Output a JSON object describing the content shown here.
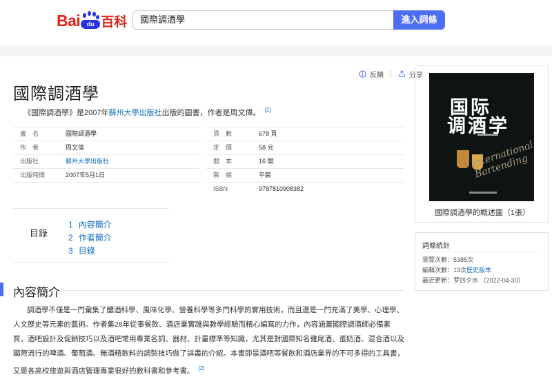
{
  "header": {
    "logo_bai": "Bai",
    "logo_du": "du",
    "logo_baike": "百科",
    "search_value": "國際調酒學",
    "search_button": "進入詞條"
  },
  "page": {
    "title": "國際調酒學",
    "actions": {
      "feedback": "反饋",
      "share": "分享"
    },
    "summary_pre": "《國際調酒學》是2007年",
    "summary_link": "蘇州大學出版社",
    "summary_post": "出版的圖書，作者是周文偉。",
    "summary_ref": "[1]"
  },
  "info": {
    "left": [
      {
        "k": "書　名",
        "v": "國際調酒學",
        "link": false
      },
      {
        "k": "作　者",
        "v": "周文偉",
        "link": false
      },
      {
        "k": "出版社",
        "v": "蘇州大學出版社",
        "link": true
      },
      {
        "k": "出版時間",
        "v": "2007年5月1日",
        "link": false
      }
    ],
    "right": [
      {
        "k": "頁　數",
        "v": "678 頁"
      },
      {
        "k": "定　價",
        "v": "58 元"
      },
      {
        "k": "開　本",
        "v": "16 開"
      },
      {
        "k": "裝　幀",
        "v": "平裝"
      },
      {
        "k": "ISBN",
        "v": "9787810908382"
      }
    ]
  },
  "toc": {
    "heading": "目錄",
    "items": [
      {
        "n": "1",
        "label": "內容簡介"
      },
      {
        "n": "2",
        "label": "作者簡介"
      },
      {
        "n": "3",
        "label": "目錄"
      }
    ]
  },
  "section": {
    "title": "內容簡介",
    "body": "調酒學不僅是一門彙集了釀酒科學、風味化學、營養科學等多門科學的實用技術，而且還是一門充滿了美學、心理學、人文歷史等元素的藝術。作者集28年從事餐飲、酒店業實踐與教學經驗而精心編寫的力作，內容涵蓋國際調酒師必備素質，酒吧設計及促銷技巧以及酒吧常用專業名詞、器材、計量標準等知識，尤其是對國際知名雞尾酒、蛋奶酒、混合酒以及國際流行的啤酒、葡萄酒、無酒精飲料的調製技巧做了詳盡的介紹。本書即是酒吧等餐飲和酒店業界的不可多得的工具書，又是各高校旅遊與酒店管理專業很好的教科書和參考書。",
    "ref": "[2]"
  },
  "cover_card": {
    "cover_t1": "国际",
    "cover_t2": "调酒学",
    "cover_script": "International Bartending",
    "caption": "國際調酒學的概述圖（1張）"
  },
  "stats": {
    "heading": "詞條統計",
    "views_label": "瀏覽次數：",
    "views": "5388次",
    "edits_label": "編輯次數：",
    "edits": "13次",
    "edits_link": "歷史版本",
    "updated_label": "最近更新：",
    "updated": "罗四夕水 （2022-04-30）"
  },
  "colors": {
    "brand_red": "#e1251b",
    "brand_blue": "#2932e1",
    "accent": "#4e6ef2",
    "link": "#136ec2"
  }
}
